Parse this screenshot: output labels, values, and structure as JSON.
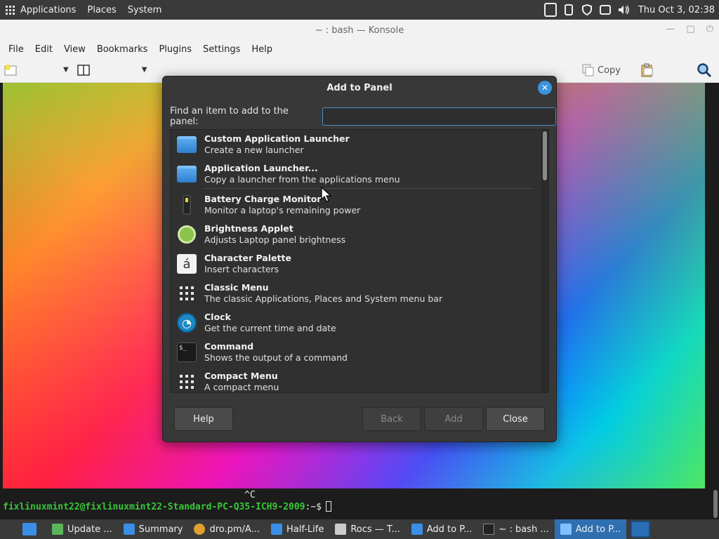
{
  "top_panel": {
    "menus": [
      "Applications",
      "Places",
      "System"
    ],
    "clock": "Thu Oct  3, 02:38"
  },
  "konsole": {
    "title": "~ : bash — Konsole",
    "menu": [
      "File",
      "Edit",
      "View",
      "Bookmarks",
      "Plugins",
      "Settings",
      "Help"
    ],
    "toolbar_copy": "Copy",
    "terminal": {
      "ctrl_c": "^C",
      "prompt_user": "fixlinuxmint22@fixlinuxmint22-Standard-PC-Q35-ICH9-2009",
      "prompt_suffix": ":~$"
    }
  },
  "dialog": {
    "title": "Add to Panel",
    "find_label": "Find an item to add to the panel:",
    "find_value": "",
    "items": [
      {
        "name": "Custom Application Launcher",
        "desc": "Create a new launcher",
        "icon": "folder-icon"
      },
      {
        "name": "Application Launcher...",
        "desc": "Copy a launcher from the applications menu",
        "icon": "folder-icon"
      },
      {
        "name": "Battery Charge Monitor",
        "desc": "Monitor a laptop's remaining power",
        "icon": "battery-icon"
      },
      {
        "name": "Brightness Applet",
        "desc": "Adjusts Laptop panel brightness",
        "icon": "brightness-icon"
      },
      {
        "name": "Character Palette",
        "desc": "Insert characters",
        "icon": "character-icon",
        "glyph": "á"
      },
      {
        "name": "Classic Menu",
        "desc": "The classic Applications, Places and System menu bar",
        "icon": "grid-menu-icon"
      },
      {
        "name": "Clock",
        "desc": "Get the current time and date",
        "icon": "clock-icon"
      },
      {
        "name": "Command",
        "desc": "Shows the output of a command",
        "icon": "terminal-icon"
      },
      {
        "name": "Compact Menu",
        "desc": "A compact menu",
        "icon": "grid-menu-icon"
      }
    ],
    "buttons": {
      "help": "Help",
      "back": "Back",
      "add": "Add",
      "close": "Close"
    }
  },
  "taskbar": {
    "tasks": [
      {
        "label": "",
        "icon": "files-icon",
        "color": "#3a8ee6"
      },
      {
        "label": "Update ...",
        "icon": "shield-icon",
        "color": "#5bb55b"
      },
      {
        "label": "Summary",
        "icon": "download-icon",
        "color": "#3a8ee6"
      },
      {
        "label": "dro.pm/A...",
        "icon": "chrome-icon",
        "color": "#e0a030"
      },
      {
        "label": "Half-Life",
        "icon": "folder-icon",
        "color": "#3a8ee6"
      },
      {
        "label": "Rocs — T...",
        "icon": "window-icon",
        "color": "#cccccc"
      },
      {
        "label": "Add to P...",
        "icon": "window-icon",
        "color": "#3a8ee6"
      },
      {
        "label": "~ : bash ...",
        "icon": "terminal-icon",
        "color": "#222222"
      },
      {
        "label": "Add to P...",
        "icon": "window-icon",
        "color": "#3a8ee6",
        "active": true
      }
    ]
  }
}
